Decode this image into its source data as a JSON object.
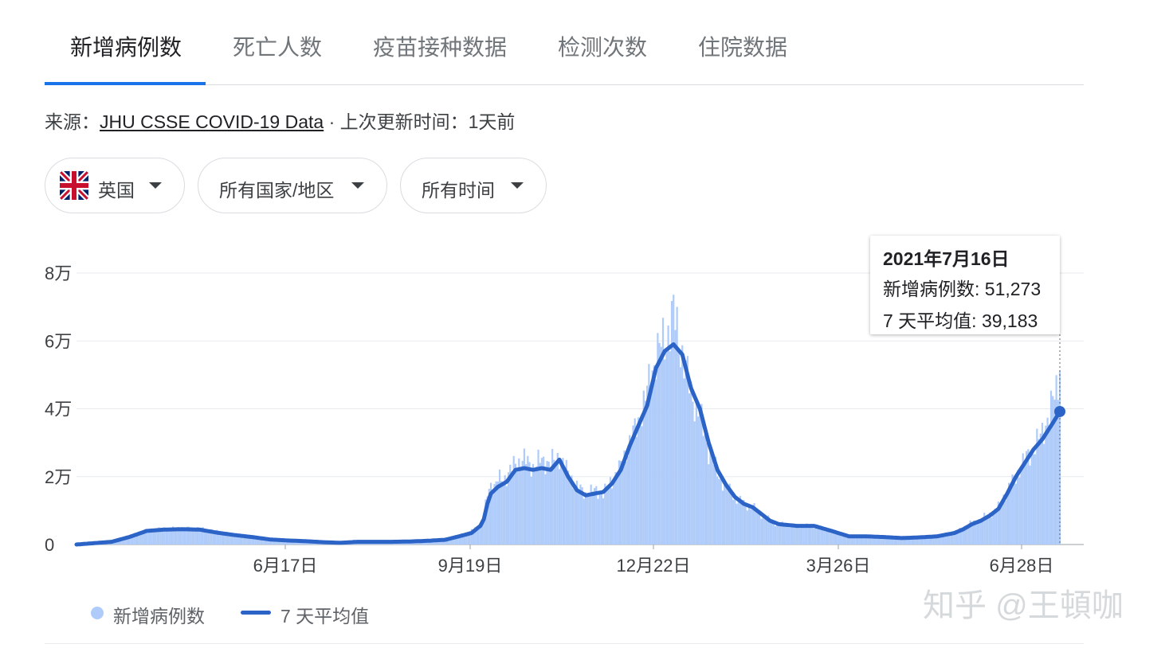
{
  "tabs": [
    "新增病例数",
    "死亡人数",
    "疫苗接种数据",
    "检测次数",
    "住院数据"
  ],
  "source": {
    "prefix": "来源：",
    "link": "JHU CSSE COVID-19 Data",
    "suffix": " · 上次更新时间：1天前"
  },
  "filters": {
    "region": "英国",
    "scope": "所有国家/地区",
    "time": "所有时间",
    "region_icon": "uk-flag-icon"
  },
  "tooltip": {
    "date": "2021年7月16日",
    "cases_label": "新增病例数: 51,273",
    "avg_label": "7 天平均值: 39,183"
  },
  "legend": {
    "cases": "新增病例数",
    "avg": "7 天平均值"
  },
  "watermark": "知乎 @王頓咖",
  "colors": {
    "bars": "#aecbfa",
    "line": "#2b63c6",
    "active_tab": "#1a73e8"
  },
  "chart_data": {
    "type": "bar",
    "x_is_days_since_first": true,
    "x_range_days": [
      0,
      536
    ],
    "ylim": [
      0,
      80000
    ],
    "y_ticks": [
      0,
      20000,
      40000,
      60000,
      80000
    ],
    "y_tick_labels": [
      "0",
      "2万",
      "4万",
      "6万",
      "8万"
    ],
    "x_ticks": [
      {
        "day": 191,
        "label": "6月17日"
      },
      {
        "day": 285,
        "label": "9月19日"
      },
      {
        "day": 379,
        "label": "12月22日"
      },
      {
        "day": 473,
        "label": "3月26日"
      },
      {
        "day": 567,
        "label": "6月28日"
      }
    ],
    "series": [
      {
        "name": "新增病例数",
        "kind": "bars",
        "points": [
          [
            0,
            0
          ],
          [
            20,
            1200
          ],
          [
            30,
            2600
          ],
          [
            40,
            4200
          ],
          [
            50,
            4600
          ],
          [
            60,
            4800
          ],
          [
            70,
            4700
          ],
          [
            80,
            3800
          ],
          [
            90,
            3000
          ],
          [
            100,
            2400
          ],
          [
            110,
            1700
          ],
          [
            120,
            1300
          ],
          [
            130,
            1100
          ],
          [
            140,
            900
          ],
          [
            150,
            700
          ],
          [
            160,
            900
          ],
          [
            170,
            900
          ],
          [
            180,
            900
          ],
          [
            190,
            1000
          ],
          [
            200,
            1300
          ],
          [
            210,
            1600
          ],
          [
            220,
            3000
          ],
          [
            225,
            4000
          ],
          [
            230,
            6000
          ],
          [
            232,
            8000
          ],
          [
            234,
            15000
          ],
          [
            236,
            18000
          ],
          [
            238,
            17000
          ],
          [
            240,
            19000
          ],
          [
            245,
            20000
          ],
          [
            250,
            24000
          ],
          [
            255,
            25000
          ],
          [
            260,
            23000
          ],
          [
            265,
            25000
          ],
          [
            270,
            24000
          ],
          [
            275,
            26000
          ],
          [
            280,
            21000
          ],
          [
            285,
            17000
          ],
          [
            290,
            15000
          ],
          [
            295,
            16000
          ],
          [
            300,
            15000
          ],
          [
            305,
            19000
          ],
          [
            310,
            23000
          ],
          [
            315,
            30000
          ],
          [
            320,
            36000
          ],
          [
            325,
            45000
          ],
          [
            330,
            56000
          ],
          [
            335,
            60000
          ],
          [
            340,
            68000
          ],
          [
            345,
            56000
          ],
          [
            350,
            45000
          ],
          [
            355,
            38000
          ],
          [
            360,
            28000
          ],
          [
            365,
            21000
          ],
          [
            370,
            17000
          ],
          [
            375,
            14000
          ],
          [
            380,
            12000
          ],
          [
            385,
            11000
          ],
          [
            390,
            9000
          ],
          [
            395,
            7000
          ],
          [
            400,
            6000
          ],
          [
            410,
            5500
          ],
          [
            420,
            5500
          ],
          [
            430,
            4000
          ],
          [
            440,
            2500
          ],
          [
            450,
            2500
          ],
          [
            460,
            2200
          ],
          [
            470,
            2000
          ],
          [
            480,
            2200
          ],
          [
            490,
            2500
          ],
          [
            500,
            3600
          ],
          [
            505,
            5000
          ],
          [
            510,
            6500
          ],
          [
            515,
            7500
          ],
          [
            520,
            9000
          ],
          [
            525,
            11000
          ],
          [
            530,
            16000
          ],
          [
            535,
            20000
          ],
          [
            540,
            25000
          ],
          [
            545,
            28000
          ],
          [
            550,
            33000
          ],
          [
            555,
            40000
          ],
          [
            558,
            46000
          ],
          [
            560,
            51273
          ]
        ]
      },
      {
        "name": "7 天平均值",
        "kind": "line",
        "points": [
          [
            0,
            0
          ],
          [
            20,
            800
          ],
          [
            30,
            2200
          ],
          [
            40,
            4000
          ],
          [
            50,
            4400
          ],
          [
            60,
            4500
          ],
          [
            70,
            4400
          ],
          [
            80,
            3500
          ],
          [
            90,
            2800
          ],
          [
            100,
            2200
          ],
          [
            110,
            1500
          ],
          [
            120,
            1200
          ],
          [
            130,
            1000
          ],
          [
            140,
            700
          ],
          [
            150,
            500
          ],
          [
            160,
            800
          ],
          [
            170,
            800
          ],
          [
            180,
            800
          ],
          [
            190,
            900
          ],
          [
            200,
            1100
          ],
          [
            210,
            1400
          ],
          [
            220,
            2700
          ],
          [
            225,
            3400
          ],
          [
            230,
            5500
          ],
          [
            232,
            7500
          ],
          [
            234,
            12000
          ],
          [
            236,
            15000
          ],
          [
            238,
            16000
          ],
          [
            240,
            17000
          ],
          [
            245,
            18500
          ],
          [
            250,
            22000
          ],
          [
            255,
            22500
          ],
          [
            260,
            22000
          ],
          [
            265,
            22500
          ],
          [
            270,
            22000
          ],
          [
            275,
            25000
          ],
          [
            280,
            20000
          ],
          [
            285,
            16000
          ],
          [
            290,
            14500
          ],
          [
            295,
            15000
          ],
          [
            300,
            15500
          ],
          [
            305,
            18000
          ],
          [
            310,
            22000
          ],
          [
            315,
            29000
          ],
          [
            320,
            35000
          ],
          [
            325,
            41000
          ],
          [
            330,
            52000
          ],
          [
            335,
            57000
          ],
          [
            340,
            59000
          ],
          [
            345,
            56000
          ],
          [
            350,
            46000
          ],
          [
            355,
            40000
          ],
          [
            360,
            30000
          ],
          [
            365,
            22000
          ],
          [
            370,
            17500
          ],
          [
            375,
            14000
          ],
          [
            380,
            12000
          ],
          [
            385,
            11000
          ],
          [
            390,
            9000
          ],
          [
            395,
            7000
          ],
          [
            400,
            6000
          ],
          [
            410,
            5500
          ],
          [
            420,
            5500
          ],
          [
            430,
            4000
          ],
          [
            440,
            2400
          ],
          [
            450,
            2400
          ],
          [
            460,
            2200
          ],
          [
            470,
            1900
          ],
          [
            480,
            2100
          ],
          [
            490,
            2400
          ],
          [
            500,
            3400
          ],
          [
            505,
            4500
          ],
          [
            510,
            6000
          ],
          [
            515,
            7000
          ],
          [
            520,
            8500
          ],
          [
            525,
            10500
          ],
          [
            530,
            15000
          ],
          [
            535,
            20000
          ],
          [
            540,
            24000
          ],
          [
            545,
            28000
          ],
          [
            550,
            31000
          ],
          [
            555,
            35000
          ],
          [
            558,
            37500
          ],
          [
            560,
            39183
          ]
        ]
      }
    ],
    "highlight_day": 560
  }
}
